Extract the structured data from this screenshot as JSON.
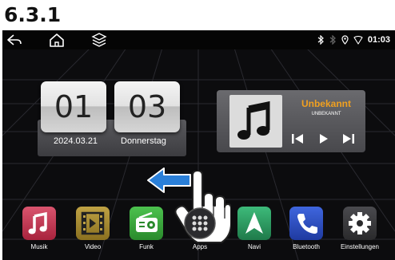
{
  "section_label": "6.3.1",
  "status": {
    "time": "01:03"
  },
  "clock": {
    "hours": "01",
    "minutes": "03",
    "date": "2024.03.21",
    "weekday": "Donnerstag"
  },
  "music": {
    "title": "Unbekannt",
    "artist": "UNBEKANNT"
  },
  "dock": [
    {
      "label": "Musik",
      "icon": "music-note-icon",
      "color": "#c4334f"
    },
    {
      "label": "Video",
      "icon": "film-icon",
      "color": "#a58a2e"
    },
    {
      "label": "Funk",
      "icon": "radio-icon",
      "color": "#3aa33c"
    },
    {
      "label": "Apps",
      "icon": "apps-icon",
      "color": "#3a3a3a"
    },
    {
      "label": "Navi",
      "icon": "navigation-icon",
      "color": "#2f9e64"
    },
    {
      "label": "Bluetooth",
      "icon": "phone-icon",
      "color": "#2b4fc4"
    },
    {
      "label": "Einstellungen",
      "icon": "gear-icon",
      "color": "#3a3a3c"
    }
  ],
  "colors": {
    "accent": "#f0a020",
    "background": "#0c0c0e"
  }
}
